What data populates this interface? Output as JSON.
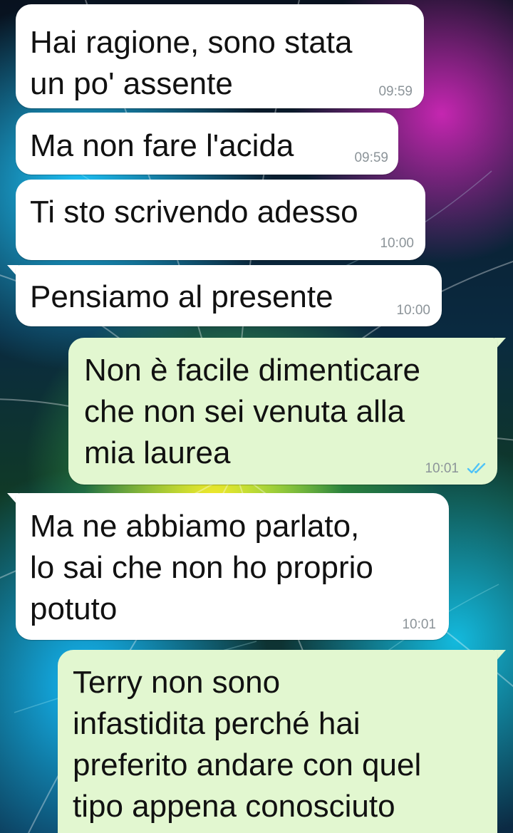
{
  "messages": [
    {
      "direction": "incoming",
      "text": "Hai ragione, sono stata\nun po' assente",
      "time": "09:59"
    },
    {
      "direction": "incoming",
      "text": "Ma non fare l'acida",
      "time": "09:59"
    },
    {
      "direction": "incoming",
      "text": "Ti sto scrivendo adesso",
      "time": "10:00"
    },
    {
      "direction": "incoming",
      "text": "Pensiamo al presente",
      "time": "10:00"
    },
    {
      "direction": "outgoing",
      "text": "Non è facile dimenticare\nche non sei venuta alla\nmia laurea",
      "time": "10:01",
      "status_icon": "double-check-read-icon"
    },
    {
      "direction": "incoming",
      "text": "Ma ne abbiamo parlato,\nlo sai che non ho proprio\npotuto",
      "time": "10:01"
    },
    {
      "direction": "outgoing",
      "text": "Terry non sono\ninfastidita perché hai\npreferito andare con quel\ntipo appena conosciuto",
      "time": ""
    }
  ],
  "colors": {
    "incoming_bubble": "#ffffff",
    "outgoing_bubble": "#e2f7d0",
    "timestamp": "#8c9499",
    "read_ticks": "#4fc3f7"
  }
}
